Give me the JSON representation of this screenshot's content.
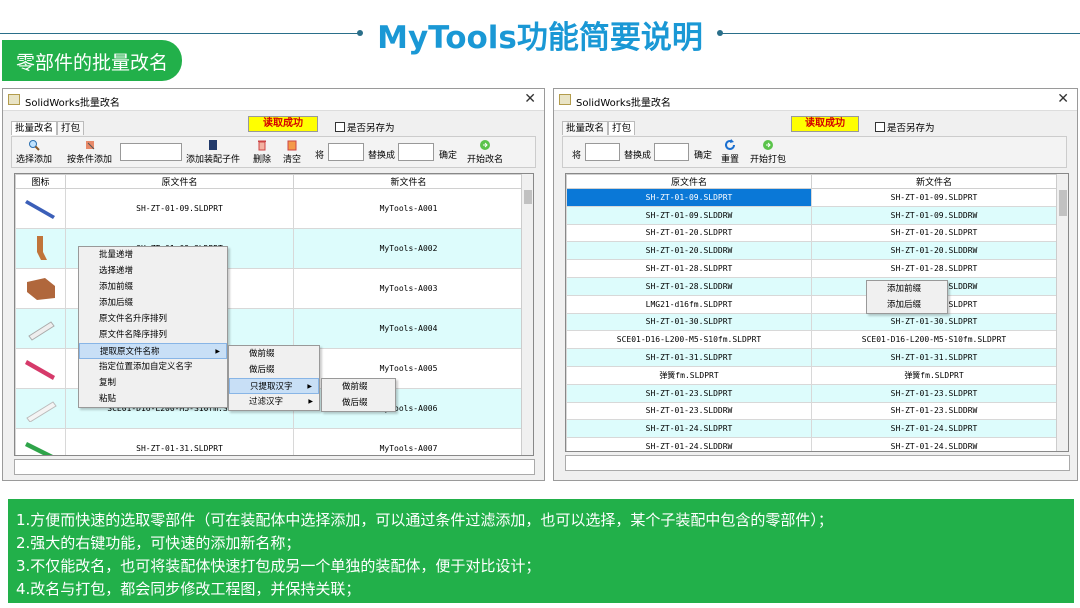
{
  "header": {
    "title": "MyTools功能简要说明",
    "section": "零部件的批量改名"
  },
  "left_window": {
    "title": "SolidWorks批量改名",
    "close_glyph": "✕",
    "tabs": [
      "批量改名",
      "打包"
    ],
    "status": "读取成功",
    "save_as_label": "是否另存为",
    "toolbar": {
      "select_add": "选择添加",
      "cond_add": "按条件添加",
      "asm_add": "添加装配子件",
      "delete": "删除",
      "clear": "清空",
      "will": "将",
      "replace_with": "替换成",
      "confirm": "确定",
      "start": "开始改名"
    },
    "columns": [
      "图标",
      "原文件名",
      "新文件名"
    ],
    "rows": [
      {
        "orig": "SH-ZT-01-09.SLDPRT",
        "new": "MyTools-A001",
        "part_color": "#3b5fb8"
      },
      {
        "orig": "SH-ZT-01-09.SLDPRT",
        "new": "MyTools-A002",
        "part_color": "#c0743a"
      },
      {
        "orig": "",
        "new": "MyTools-A003",
        "part_color": "#b0673c"
      },
      {
        "orig": "",
        "new": "MyTools-A004",
        "part_color": "#e8e8e8"
      },
      {
        "orig": "",
        "new": "MyTools-A005",
        "part_color": "#d63a6a"
      },
      {
        "orig": "SCE01-D16-L200-M5-S10fm.SLDPRT",
        "new": "MyTools-A006",
        "part_color": "#f0f0f0"
      },
      {
        "orig": "SH-ZT-01-31.SLDPRT",
        "new": "MyTools-A007",
        "part_color": "#2fa44a"
      }
    ],
    "context_menu": [
      "批量递增",
      "选择递增",
      "添加前缀",
      "添加后缀",
      "原文件名升序排列",
      "原文件名降序排列",
      "提取原文件名称",
      "指定位置添加自定义名字",
      "复制",
      "粘贴"
    ],
    "submenu1": [
      "做前缀",
      "做后缀",
      "只提取汉字",
      "过滤汉字"
    ],
    "submenu2": [
      "做前缀",
      "做后缀"
    ]
  },
  "right_window": {
    "title": "SolidWorks批量改名",
    "close_glyph": "✕",
    "tabs": [
      "批量改名",
      "打包"
    ],
    "status": "读取成功",
    "save_as_label": "是否另存为",
    "toolbar": {
      "will": "将",
      "replace_with": "替换成",
      "confirm": "确定",
      "reset": "重置",
      "start": "开始打包"
    },
    "columns": [
      "原文件名",
      "新文件名"
    ],
    "rows": [
      [
        "SH-ZT-01-09.SLDPRT",
        "SH-ZT-01-09.SLDPRT"
      ],
      [
        "SH-ZT-01-09.SLDDRW",
        "SH-ZT-01-09.SLDDRW"
      ],
      [
        "SH-ZT-01-20.SLDPRT",
        "SH-ZT-01-20.SLDPRT"
      ],
      [
        "SH-ZT-01-20.SLDDRW",
        "SH-ZT-01-20.SLDDRW"
      ],
      [
        "SH-ZT-01-28.SLDPRT",
        "SH-ZT-01-28.SLDPRT"
      ],
      [
        "SH-ZT-01-28.SLDDRW",
        "SH-ZT-01-28.SLDDRW"
      ],
      [
        "LMG21-d16fm.SLDPRT",
        "LMG21-d16fm.SLDPRT"
      ],
      [
        "SH-ZT-01-30.SLDPRT",
        "SH-ZT-01-30.SLDPRT"
      ],
      [
        "SCE01-D16-L200-M5-S10fm.SLDPRT",
        "SCE01-D16-L200-M5-S10fm.SLDPRT"
      ],
      [
        "SH-ZT-01-31.SLDPRT",
        "SH-ZT-01-31.SLDPRT"
      ],
      [
        "弹簧fm.SLDPRT",
        "弹簧fm.SLDPRT"
      ],
      [
        "SH-ZT-01-23.SLDPRT",
        "SH-ZT-01-23.SLDPRT"
      ],
      [
        "SH-ZT-01-23.SLDDRW",
        "SH-ZT-01-23.SLDDRW"
      ],
      [
        "SH-ZT-01-24.SLDPRT",
        "SH-ZT-01-24.SLDPRT"
      ],
      [
        "SH-ZT-01-24.SLDDRW",
        "SH-ZT-01-24.SLDDRW"
      ]
    ],
    "context_menu": [
      "添加前缀",
      "添加后缀"
    ]
  },
  "description": [
    "1.方便而快速的选取零部件（可在装配体中选择添加，可以通过条件过滤添加，也可以选择，某个子装配中包含的零部件）；",
    "2.强大的右键功能，可快速的添加新名称；",
    "3.不仅能改名，也可将装配体快速打包成另一个单独的装配体，便于对比设计；",
    "4.改名与打包，都会同步修改工程图，并保持关联；"
  ]
}
